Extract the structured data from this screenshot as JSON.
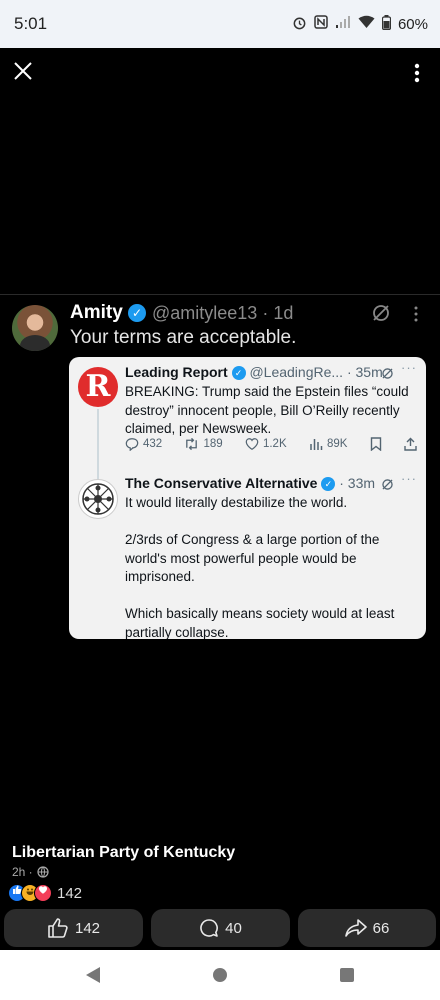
{
  "status_bar": {
    "time": "5:01",
    "battery": "60%",
    "icons": [
      "alarm-icon",
      "nfc-icon",
      "signal-icon",
      "wifi-icon",
      "battery-icon"
    ]
  },
  "top_bar": {
    "icons": [
      "close-icon",
      "more-vertical-icon"
    ]
  },
  "tweet": {
    "author_name": "Amity",
    "author_handle": "@amitylee13 · 1d",
    "text": "Your terms are acceptable.",
    "verified": true
  },
  "quoted_thread": {
    "first": {
      "name": "Leading Report",
      "handle": "@LeadingRe... · 35m",
      "avatar_letter": "R",
      "text": "BREAKING: Trump said the Epstein files “could destroy” innocent people, Bill O’Reilly recently claimed, per Newsweek.",
      "replies": "432",
      "reposts": "189",
      "likes": "1.2K",
      "views": "89K"
    },
    "second": {
      "name": "The Conservative Alternative",
      "handle": "· 33m",
      "text": "It would literally destabilize the world.\n\n2/3rds of Congress & a large portion of the world's most powerful people would be imprisoned.\n\nWhich basically means society would at least partially collapse."
    }
  },
  "post": {
    "page_name": "Libertarian Party of Kentucky",
    "time": "2h ·",
    "reaction_count": "142",
    "reaction_icons": [
      "like-reaction-icon",
      "haha-reaction-icon",
      "love-reaction-icon"
    ]
  },
  "actions": {
    "like_count": "142",
    "comment_count": "40",
    "share_count": "66"
  },
  "colors": {
    "background": "#000000",
    "twitter_blue": "#1d9bf0",
    "leading_report_red": "#e02c2c",
    "button_bg": "#2b2b2b"
  }
}
